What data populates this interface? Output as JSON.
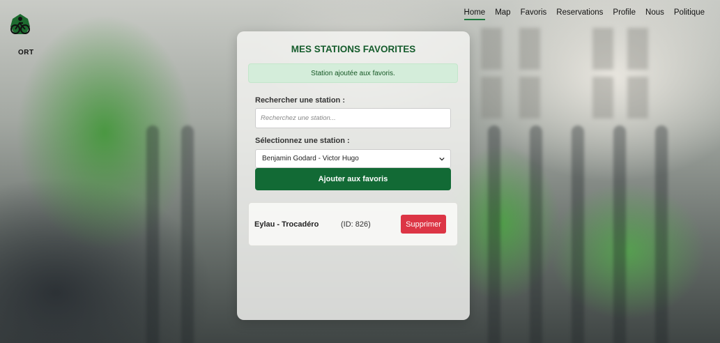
{
  "logo": {
    "text": "ORT"
  },
  "nav": {
    "items": [
      {
        "label": "Home"
      },
      {
        "label": "Map"
      },
      {
        "label": "Favoris"
      },
      {
        "label": "Reservations"
      },
      {
        "label": "Profile"
      },
      {
        "label": "Nous"
      },
      {
        "label": "Politique"
      }
    ],
    "active": "Home"
  },
  "card": {
    "title": "MES STATIONS FAVORITES",
    "alert": "Station ajoutée aux favoris.",
    "search_label": "Rechercher une station :",
    "search_placeholder": "Recherchez une station...",
    "search_value": "",
    "select_label": "Sélectionnez une station :",
    "select_value": "Benjamin Godard - Victor Hugo",
    "add_button": "Ajouter aux favoris"
  },
  "favorites": [
    {
      "name": "Eylau - Trocadéro",
      "id_text": "(ID: 826)",
      "delete_label": "Supprimer"
    }
  ],
  "colors": {
    "primary_green": "#126a35",
    "title_green": "#155c2c",
    "alert_bg": "#d4edda",
    "danger": "#dc3545"
  }
}
